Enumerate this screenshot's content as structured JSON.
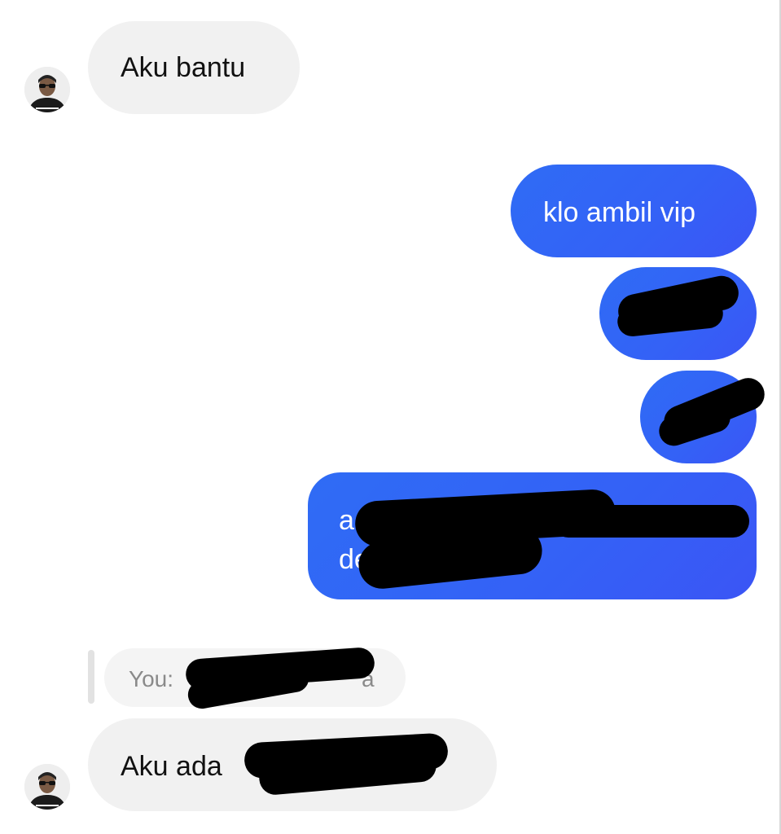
{
  "messages": [
    {
      "id": "m1",
      "direction": "incoming",
      "text": "Aku bantu"
    },
    {
      "id": "m2",
      "direction": "outgoing",
      "text": "klo ambil vip"
    },
    {
      "id": "m3",
      "direction": "outgoing",
      "text": ""
    },
    {
      "id": "m4",
      "direction": "outgoing",
      "text": ""
    },
    {
      "id": "m5",
      "direction": "outgoing",
      "line1": "a",
      "line2": "de"
    },
    {
      "id": "m6",
      "direction": "incoming",
      "text": "Aku ada"
    }
  ],
  "reply_preview": {
    "prefix": "You:",
    "tail": "a"
  },
  "colors": {
    "incoming_bubble": "#f1f1f1",
    "outgoing_bubble": "#2f6cf5",
    "redaction": "#000000"
  }
}
